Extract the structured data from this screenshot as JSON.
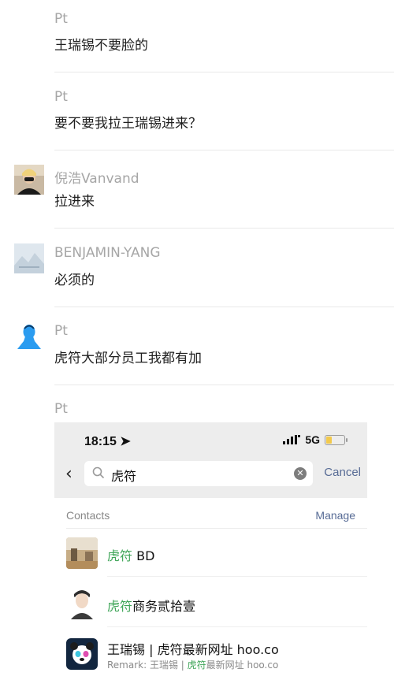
{
  "messages": [
    {
      "sender": "Pt",
      "text": "王瑞锡不要脸的",
      "avatar": "none"
    },
    {
      "sender": "Pt",
      "text": "要不要我拉王瑞锡进来？",
      "avatar": "none"
    },
    {
      "sender": "倪浩Vanvand",
      "text": "拉进来",
      "avatar": "person-photo"
    },
    {
      "sender": "BENJAMIN-YANG",
      "text": "必须的",
      "avatar": "landscape-placeholder"
    },
    {
      "sender": "Pt",
      "text": "虎符大部分员工我都有加",
      "avatar": "blue-silhouette"
    },
    {
      "sender": "Pt"
    }
  ],
  "embedded": {
    "status_time": "18:15",
    "status_network": "5G",
    "battery_level": 0.3,
    "battery_color": "#f2c94c",
    "search_query": "虎符",
    "cancel_label": "Cancel",
    "section_label": "Contacts",
    "manage_label": "Manage",
    "highlight_color": "#3fa558",
    "link_color": "#576b95",
    "contacts": [
      {
        "highlight": "虎符",
        "rest": " BD"
      },
      {
        "highlight": "虎符",
        "rest": "商务贰拾壹"
      },
      {
        "name": "王瑞锡 | 虎符最新网址 hoo.co",
        "remark_prefix": "Remark: 王瑞锡 | ",
        "remark_highlight": "虎符",
        "remark_rest": "最新网址 hoo.co"
      }
    ]
  }
}
